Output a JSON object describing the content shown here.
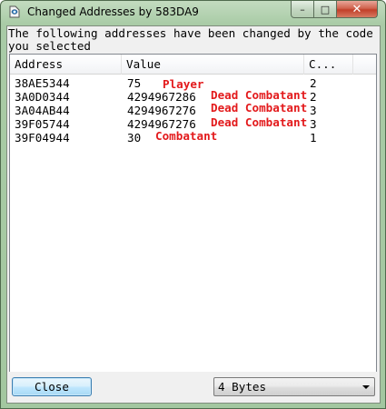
{
  "window": {
    "title": "Changed Addresses by 583DA9",
    "buttons": {
      "minimize": "–",
      "maximize": "□",
      "close": "✕"
    }
  },
  "message": "The following addresses have been changed by the code you selected",
  "table": {
    "columns": [
      "Address",
      "Value",
      "C..."
    ],
    "rows": [
      {
        "address": "38AE5344",
        "value": "75",
        "count": "2",
        "annotation": "Player"
      },
      {
        "address": "3A0D0344",
        "value": "4294967286",
        "count": "2",
        "annotation": "Dead Combatant"
      },
      {
        "address": "3A04AB44",
        "value": "4294967276",
        "count": "3",
        "annotation": "Dead Combatant"
      },
      {
        "address": "39F05744",
        "value": "4294967276",
        "count": "3",
        "annotation": "Dead Combatant"
      },
      {
        "address": "39F04944",
        "value": "30",
        "count": "1",
        "annotation": "Combatant"
      }
    ]
  },
  "footer": {
    "close_label": "Close",
    "type_value": "4 Bytes"
  },
  "colors": {
    "annotation": "#e31a1c",
    "titlebar": "#a9cba6",
    "close_button": "#c2402a"
  },
  "icons": [
    "cheat-engine-app-icon",
    "minimize-icon",
    "maximize-icon",
    "close-icon",
    "dropdown-arrow-icon"
  ]
}
